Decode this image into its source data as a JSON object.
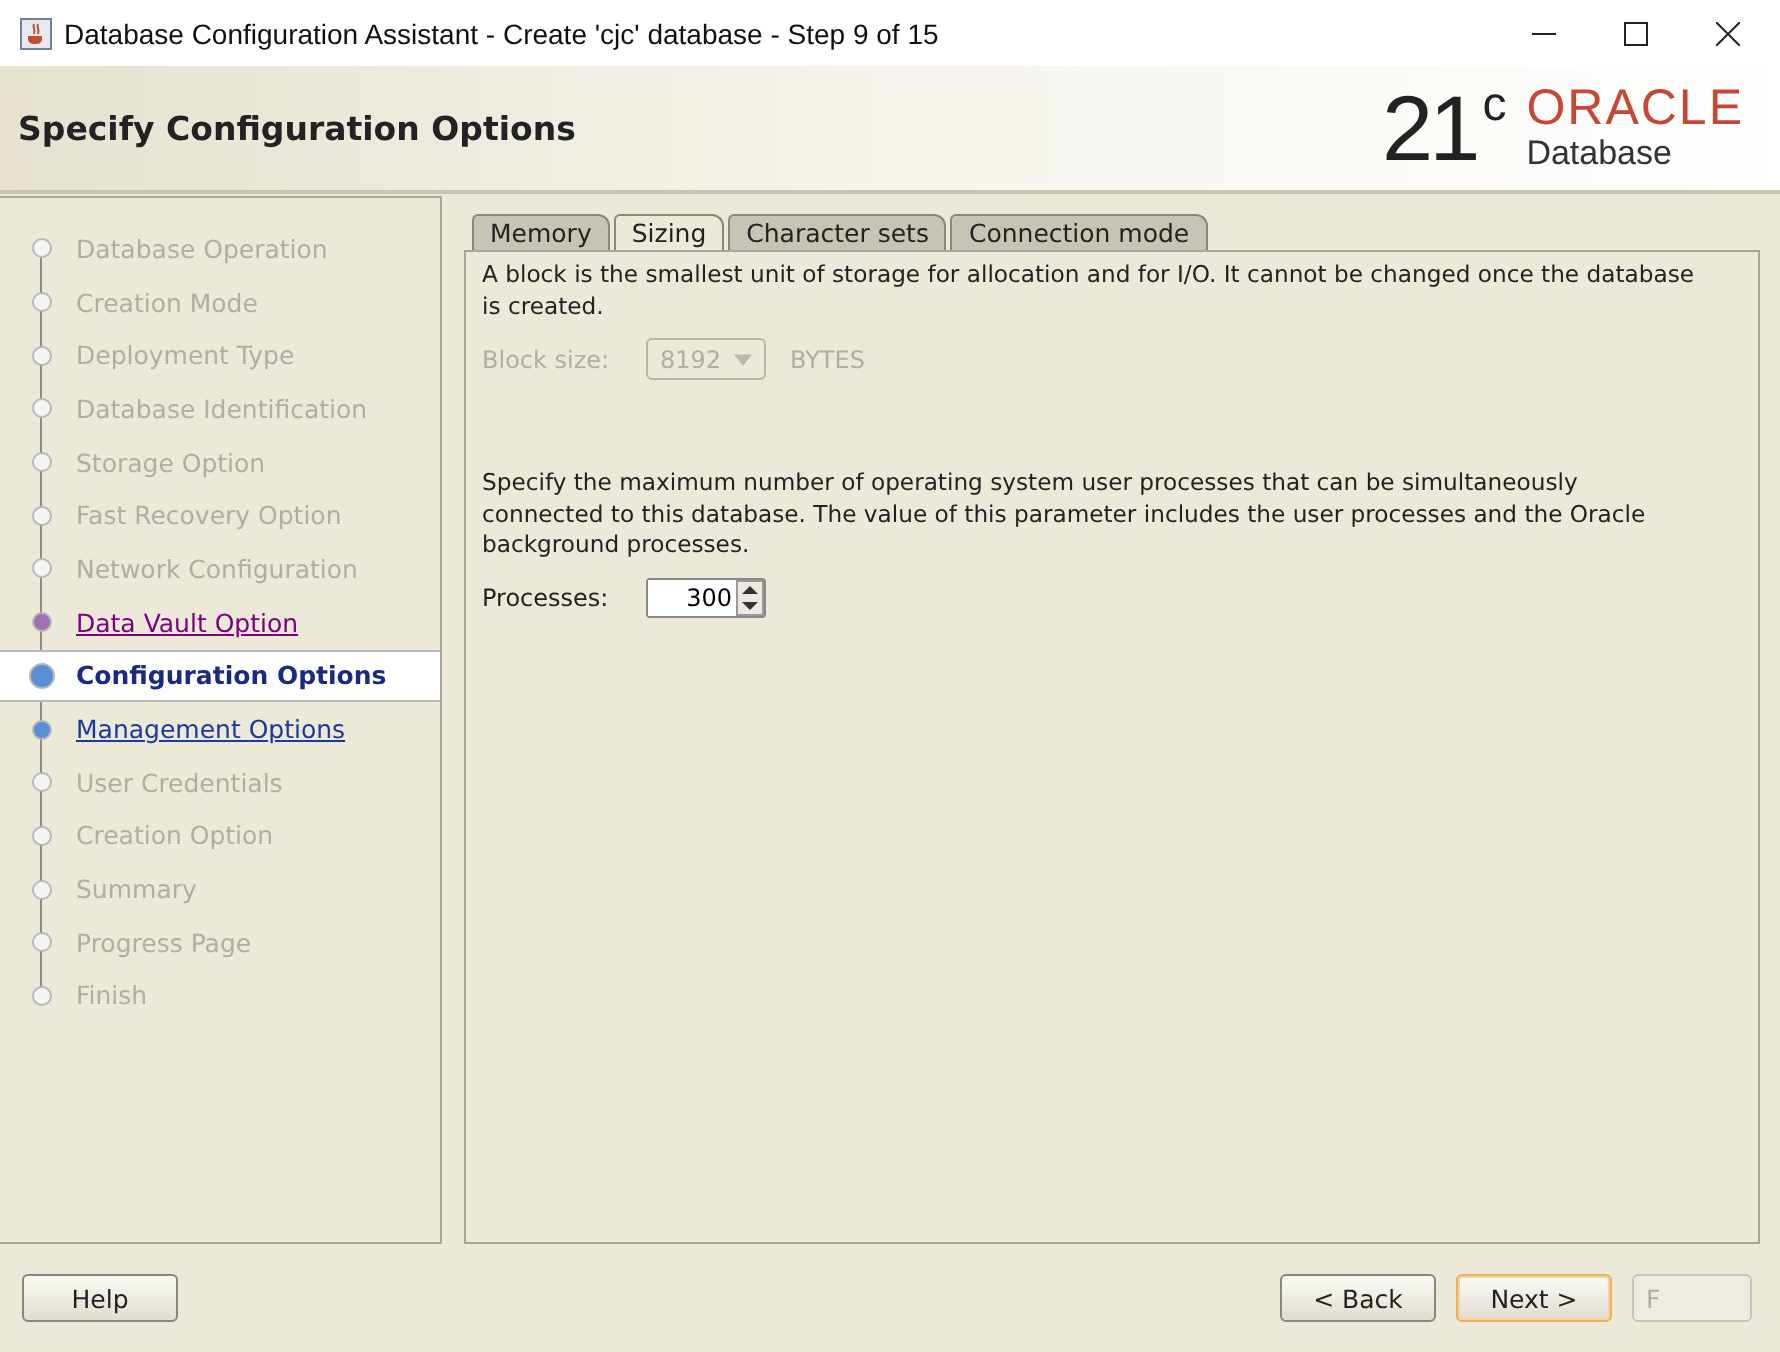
{
  "window": {
    "title": "Database Configuration Assistant - Create 'cjc' database - Step 9 of 15"
  },
  "header": {
    "title": "Specify Configuration Options",
    "logo_version": "21",
    "logo_sup": "c",
    "logo_brand": "ORACLE",
    "logo_product": "Database"
  },
  "steps": [
    {
      "label": "Database Operation",
      "kind": "disabled",
      "selected": false
    },
    {
      "label": "Creation Mode",
      "kind": "disabled",
      "selected": false
    },
    {
      "label": "Deployment Type",
      "kind": "disabled",
      "selected": false
    },
    {
      "label": "Database Identification",
      "kind": "disabled",
      "selected": false
    },
    {
      "label": "Storage Option",
      "kind": "disabled",
      "selected": false
    },
    {
      "label": "Fast Recovery Option",
      "kind": "disabled",
      "selected": false
    },
    {
      "label": "Network Configuration",
      "kind": "disabled",
      "selected": false
    },
    {
      "label": "Data Vault Option",
      "kind": "visited",
      "selected": false
    },
    {
      "label": "Configuration Options",
      "kind": "current",
      "selected": true
    },
    {
      "label": "Management Options",
      "kind": "link",
      "selected": false
    },
    {
      "label": "User Credentials",
      "kind": "disabled",
      "selected": false
    },
    {
      "label": "Creation Option",
      "kind": "disabled",
      "selected": false
    },
    {
      "label": "Summary",
      "kind": "disabled",
      "selected": false
    },
    {
      "label": "Progress Page",
      "kind": "disabled",
      "selected": false
    },
    {
      "label": "Finish",
      "kind": "disabled",
      "selected": false
    }
  ],
  "tabs": [
    {
      "label": "Memory",
      "selected": false
    },
    {
      "label": "Sizing",
      "selected": true
    },
    {
      "label": "Character sets",
      "selected": false
    },
    {
      "label": "Connection mode",
      "selected": false
    }
  ],
  "sizing": {
    "block_note": "A block is the smallest unit of storage for allocation and for I/O. It cannot be changed once the database is created.",
    "block_size": {
      "label": "Block size:",
      "value": "8192",
      "unit": "BYTES",
      "disabled": true
    },
    "processes_note": "Specify the maximum number of operating system user processes that can be simultaneously connected to this database. The value of this parameter includes the user processes and the Oracle background processes.",
    "processes": {
      "label": "Processes:",
      "value": "300"
    }
  },
  "buttons": [
    {
      "label": "Help",
      "kind": "help",
      "disabled": false,
      "focused": false
    },
    {
      "label": "< Back",
      "kind": "nav",
      "disabled": false,
      "focused": false
    },
    {
      "label": "Next >",
      "kind": "nav",
      "disabled": false,
      "focused": true
    },
    {
      "label": "F",
      "kind": "nav",
      "disabled": true,
      "focused": false
    }
  ]
}
